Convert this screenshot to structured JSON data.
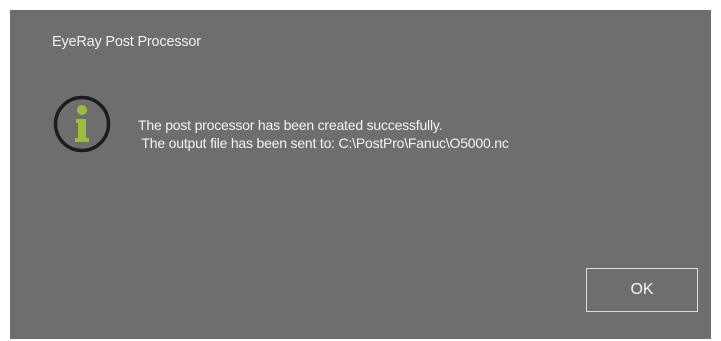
{
  "dialog": {
    "title": "EyeRay Post Processor",
    "icon": "info-icon",
    "message_line1": "The post processor has been created successfully.",
    "message_line2": " The output file has been sent to: C:\\PostPro\\Fanuc\\O5000.nc",
    "ok_label": "OK"
  },
  "colors": {
    "dialog_background": "#6e6e6e",
    "icon_accent": "#9cbf3b",
    "text": "#f2f2f2"
  }
}
